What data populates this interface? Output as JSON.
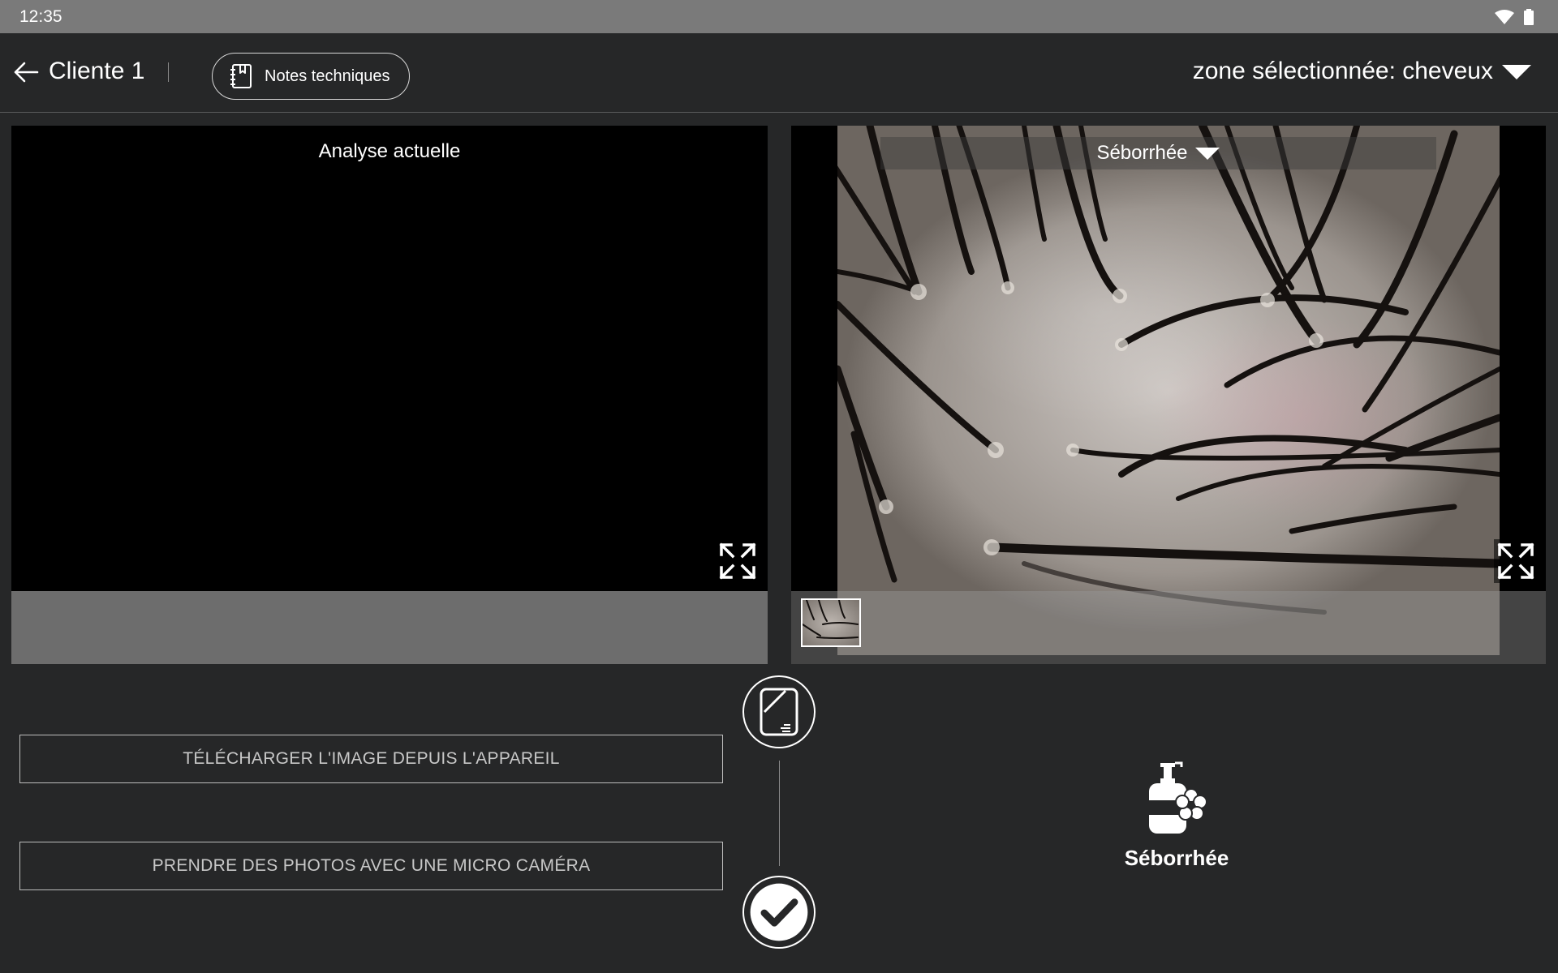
{
  "status_bar": {
    "time": "12:35",
    "icons": [
      "wifi-icon",
      "battery-icon"
    ]
  },
  "header": {
    "client_name": "Cliente 1",
    "notes_button_label": "Notes techniques",
    "zone_label": "zone sélectionnée: cheveux"
  },
  "panels": {
    "current": {
      "title": "Analyse actuelle"
    },
    "reference": {
      "dropdown_value": "Séborrhée"
    }
  },
  "actions": {
    "upload_label": "TÉLÉCHARGER L'IMAGE DEPUIS L'APPAREIL",
    "camera_label": "PRENDRE DES PHOTOS AVEC UNE MICRO CAMÉRA"
  },
  "condition": {
    "label": "Séborrhée",
    "icon": "lotion-flower-icon"
  },
  "colors": {
    "background": "#262728",
    "status_bar": "#7a7a7a",
    "panel_footer": "#6d6d6d",
    "text": "#ffffff"
  }
}
